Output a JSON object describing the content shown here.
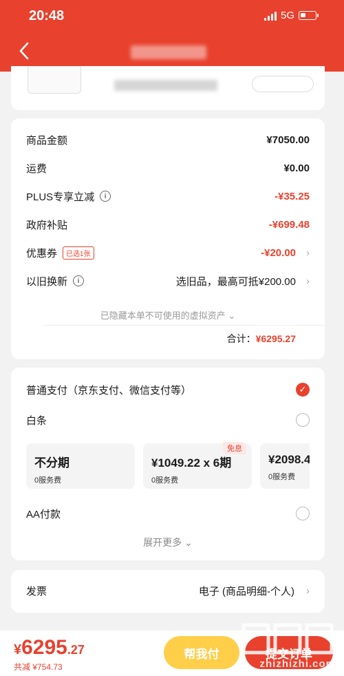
{
  "status_bar": {
    "time": "20:48",
    "network": "5G"
  },
  "price_details": {
    "rows": [
      {
        "label": "商品金额",
        "value": "¥7050.00"
      },
      {
        "label": "运费",
        "value": "¥0.00"
      },
      {
        "label": "PLUS专享立减",
        "value": "-¥35.25"
      },
      {
        "label": "政府补贴",
        "value": "-¥699.48"
      },
      {
        "label": "优惠券",
        "badge": "已选1张",
        "value": "-¥20.00"
      },
      {
        "label": "以旧换新",
        "value": "选旧品，最高可抵¥200.00"
      }
    ],
    "hidden_note": "已隐藏本单不可使用的虚拟资产",
    "total_label": "合计：",
    "total_value": "¥6295.27"
  },
  "payment": {
    "options": [
      {
        "label": "普通支付（京东支付、微信支付等）",
        "selected": true
      },
      {
        "label": "白条",
        "selected": false
      },
      {
        "label": "AA付款",
        "selected": false
      }
    ],
    "plans": [
      {
        "title": "不分期",
        "fee": "0服务费"
      },
      {
        "title": "¥1049.22 x 6期",
        "fee": "0服务费",
        "tag": "免息"
      },
      {
        "title": "¥2098.4",
        "fee": "0服务费"
      }
    ],
    "expand_label": "展开更多"
  },
  "invoice": {
    "label": "发票",
    "value": "电子 (商品明细-个人)"
  },
  "bottom_bar": {
    "price_symbol": "¥",
    "price_integer": "6295",
    "price_decimal": ".27",
    "saved": "共减 ¥754.73",
    "help_pay": "帮我付",
    "submit": "提交订单"
  },
  "watermark": "zhizhizhi.com",
  "colors": {
    "accent": "#e8412e",
    "help_button": "#ffcf4a",
    "background": "#f2f2f2"
  }
}
